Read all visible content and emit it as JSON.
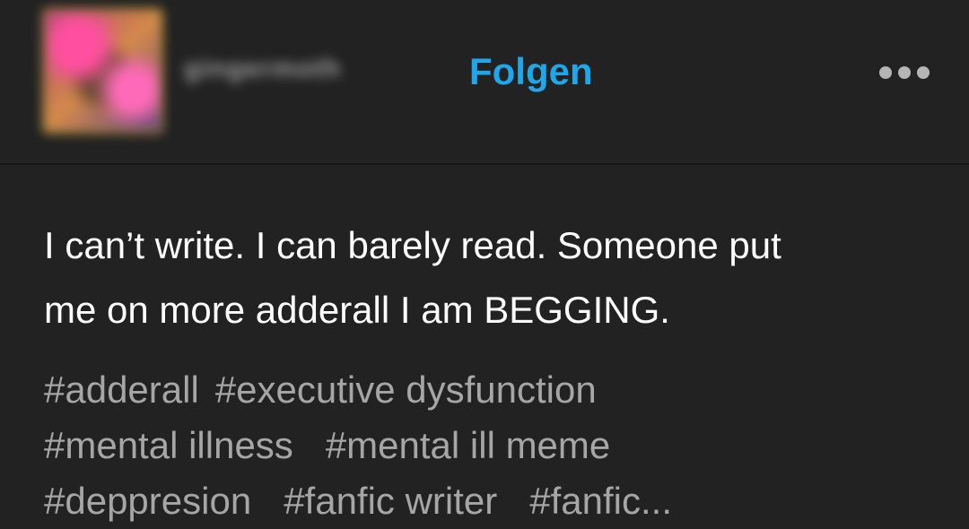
{
  "header": {
    "username": "gingermoth",
    "follow_label": "Folgen",
    "more_icon": "more-horizontal-icon"
  },
  "post": {
    "text_line1": "I can’t write. I can barely read. Someone put",
    "text_line2": "me on more adderall I am BEGGING."
  },
  "tags": [
    "#adderall",
    "#executive dysfunction",
    "#mental illness",
    "#mental ill meme",
    "#deppresion",
    "#fanfic writer",
    "#fanfic..."
  ],
  "colors": {
    "background": "#222222",
    "accent": "#1ea7ea",
    "text": "#ffffff",
    "tag_text": "#a6a6a6"
  }
}
